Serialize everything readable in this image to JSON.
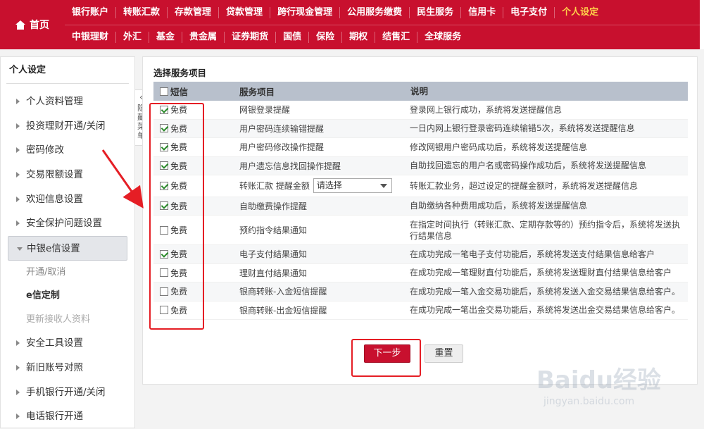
{
  "nav": {
    "home": "首页",
    "row1": [
      "银行账户",
      "转账汇款",
      "存款管理",
      "贷款管理",
      "跨行现金管理",
      "公用服务缴费",
      "民生服务",
      "信用卡",
      "电子支付",
      "个人设定"
    ],
    "row2": [
      "中银理财",
      "外汇",
      "基金",
      "贵金属",
      "证券期货",
      "国债",
      "保险",
      "期权",
      "结售汇",
      "全球服务"
    ],
    "active": "个人设定"
  },
  "sidebar": {
    "title": "个人设定",
    "items": [
      "个人资料管理",
      "投资理财开通/关闭",
      "密码修改",
      "交易限额设置",
      "欢迎信息设置",
      "安全保护问题设置"
    ],
    "open_item": "中银e信设置",
    "subitems": [
      "开通/取消",
      "e信定制",
      "更新接收人资料"
    ],
    "items_after": [
      "安全工具设置",
      "新旧账号对照",
      "手机银行开通/关闭",
      "电话银行开通"
    ],
    "collapse_label": "隐藏菜单"
  },
  "main": {
    "title": "选择服务项目",
    "headers": {
      "sms": "短信",
      "service": "服务项目",
      "desc": "说明"
    },
    "rows": [
      {
        "checked": true,
        "fee": "免费",
        "service": "网银登录提醒",
        "desc": "登录网上银行成功，系统将发送提醒信息"
      },
      {
        "checked": true,
        "fee": "免费",
        "service": "用户密码连续输错提醒",
        "desc": "一日内网上银行登录密码连续输错5次，系统将发送提醒信息"
      },
      {
        "checked": true,
        "fee": "免费",
        "service": "用户密码修改操作提醒",
        "desc": "修改网银用户密码成功后，系统将发送提醒信息"
      },
      {
        "checked": true,
        "fee": "免费",
        "service": "用户遗忘信息找回操作提醒",
        "desc": "自助找回遗忘的用户名或密码操作成功后，系统将发送提醒信息"
      },
      {
        "checked": true,
        "fee": "免费",
        "service": "转账汇款 提醒金额",
        "select": "请选择",
        "desc": "转账汇款业务，超过设定的提醒金额时，系统将发送提醒信息"
      },
      {
        "checked": true,
        "fee": "免费",
        "service": "自助缴费操作提醒",
        "desc": "自助缴纳各种费用成功后，系统将发送提醒信息"
      },
      {
        "checked": false,
        "fee": "免费",
        "service": "预约指令结果通知",
        "desc": "在指定时间执行（转账汇款、定期存款等的）预约指令后，系统将发送执行结果信息"
      },
      {
        "checked": true,
        "fee": "免费",
        "service": "电子支付结果通知",
        "desc": "在成功完成一笔电子支付功能后，系统将发送支付结果信息给客户"
      },
      {
        "checked": false,
        "fee": "免费",
        "service": "理财直付结果通知",
        "desc": "在成功完成一笔理财直付功能后，系统将发送理财直付结果信息给客户"
      },
      {
        "checked": false,
        "fee": "免费",
        "service": "银商转账-入金短信提醒",
        "desc": "在成功完成一笔入金交易功能后，系统将发送入金交易结果信息给客户。"
      },
      {
        "checked": false,
        "fee": "免费",
        "service": "银商转账-出金短信提醒",
        "desc": "在成功完成一笔出金交易功能后，系统将发送出金交易结果信息给客户。"
      }
    ],
    "next_button": "下一步",
    "reset_button": "重置"
  },
  "watermark": {
    "brand": "Baidu经验",
    "url": "jingyan.baidu.com"
  },
  "colors": {
    "brand_red": "#c8102e",
    "active_nav": "#ffd24a",
    "annotation": "#e51e25",
    "header_bg": "#b8c0cc"
  }
}
